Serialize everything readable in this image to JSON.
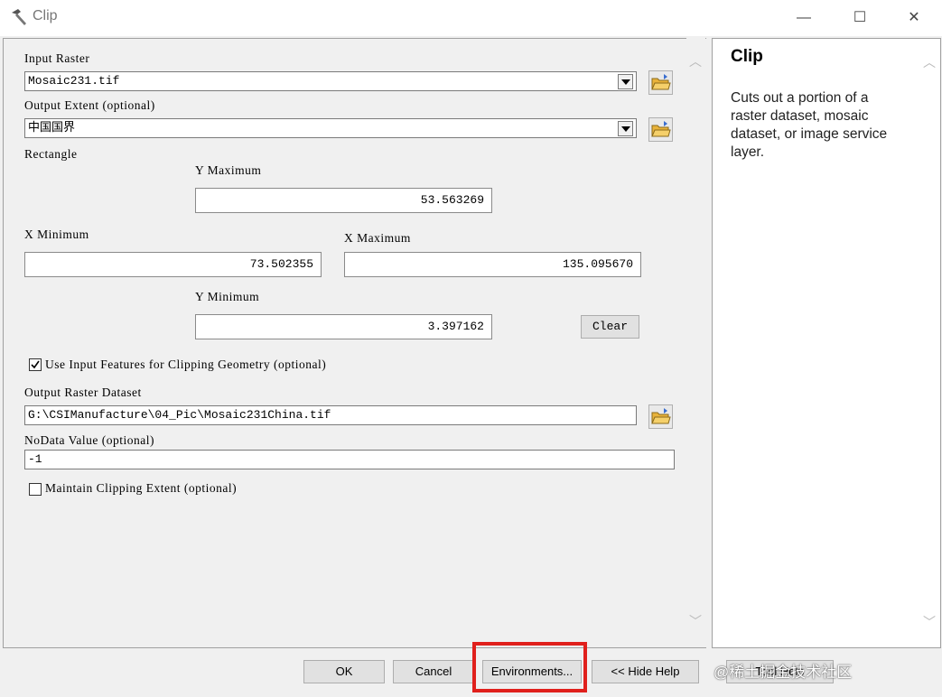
{
  "window": {
    "title": "Clip",
    "controls": {
      "minimize": "—",
      "maximize": "☐",
      "close": "✕"
    }
  },
  "form": {
    "input_raster": {
      "label": "Input Raster",
      "value": "Mosaic231.tif"
    },
    "output_extent": {
      "label": "Output Extent (optional)",
      "value": "中国国界"
    },
    "rectangle": {
      "label": "Rectangle",
      "y_max": {
        "label": "Y Maximum",
        "value": "53.563269"
      },
      "x_min": {
        "label": "X Minimum",
        "value": "73.502355"
      },
      "x_max": {
        "label": "X Maximum",
        "value": "135.095670"
      },
      "y_min": {
        "label": "Y Minimum",
        "value": "3.397162"
      },
      "clear_label": "Clear"
    },
    "use_input_features": {
      "label": "Use Input Features for Clipping Geometry (optional)",
      "checked": true
    },
    "output_raster": {
      "label": "Output Raster Dataset",
      "value": "G:\\CSIManufacture\\04_Pic\\Mosaic231China.tif"
    },
    "nodata": {
      "label": "NoData Value (optional)",
      "value": "-1"
    },
    "maintain_extent": {
      "label": "Maintain Clipping Extent (optional)",
      "checked": false
    }
  },
  "help": {
    "title": "Clip",
    "text": "Cuts out a portion of a raster dataset, mosaic dataset, or image service layer."
  },
  "buttons": {
    "ok": "OK",
    "cancel": "Cancel",
    "environments": "Environments...",
    "hide_help": "<< Hide Help",
    "tool_help": "Tool Help"
  },
  "watermark": "@稀土掘金技术社区",
  "colors": {
    "highlight": "#e0201c",
    "folder": "#e8b23a"
  }
}
